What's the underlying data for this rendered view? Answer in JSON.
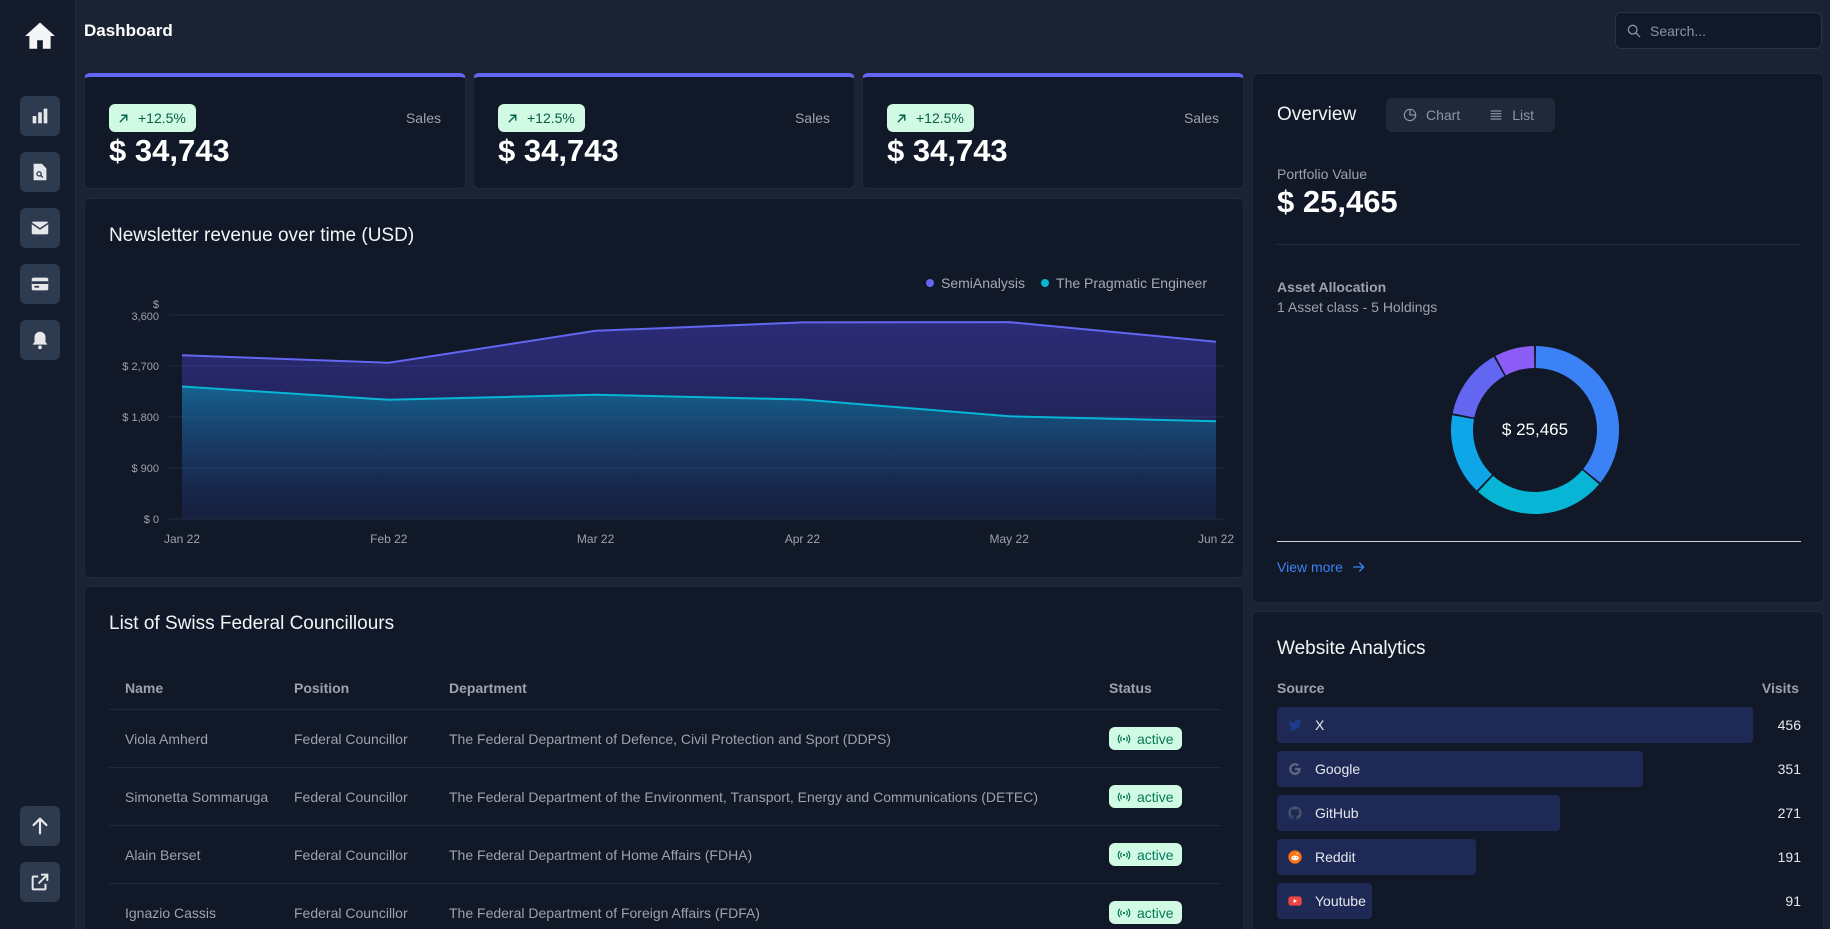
{
  "header": {
    "title": "Dashboard",
    "search_placeholder": "Search..."
  },
  "sidebar": {
    "items": [
      {
        "name": "analytics",
        "icon": "bar-chart-icon"
      },
      {
        "name": "documents",
        "icon": "document-search-icon"
      },
      {
        "name": "mail",
        "icon": "envelope-icon"
      },
      {
        "name": "payments",
        "icon": "credit-card-icon"
      },
      {
        "name": "notifications",
        "icon": "bell-icon"
      }
    ],
    "bottom": [
      {
        "name": "upload",
        "icon": "arrow-up-icon"
      },
      {
        "name": "external",
        "icon": "external-link-icon"
      }
    ]
  },
  "kpis": [
    {
      "badge": "+12.5%",
      "label": "Sales",
      "value": "$ 34,743"
    },
    {
      "badge": "+12.5%",
      "label": "Sales",
      "value": "$ 34,743"
    },
    {
      "badge": "+12.5%",
      "label": "Sales",
      "value": "$ 34,743"
    }
  ],
  "chart": {
    "title": "Newsletter revenue over time (USD)",
    "legend": [
      "SemiAnalysis",
      "The Pragmatic Engineer"
    ]
  },
  "chart_data": {
    "type": "area",
    "title": "Newsletter revenue over time (USD)",
    "x": [
      "Jan 22",
      "Feb 22",
      "Mar 22",
      "Apr 22",
      "May 22",
      "Jun 22"
    ],
    "y_ticks": [
      "$ 0",
      "$ 900",
      "$ 1,800",
      "$ 2,700",
      "$\n3,600"
    ],
    "ylim": [
      0,
      3600
    ],
    "grid": true,
    "legend_position": "top-right",
    "series": [
      {
        "name": "SemiAnalysis",
        "color": "#6366f1",
        "values": [
          2890,
          2756,
          3322,
          3470,
          3475,
          3129
        ]
      },
      {
        "name": "The Pragmatic Engineer",
        "color": "#06b6d4",
        "values": [
          2338,
          2103,
          2194,
          2108,
          1812,
          1726
        ]
      }
    ]
  },
  "table": {
    "title": "List of Swiss Federal Councillours",
    "columns": [
      "Name",
      "Position",
      "Department",
      "Status"
    ],
    "rows": [
      {
        "name": "Viola Amherd",
        "position": "Federal Councillor",
        "department": "The Federal Department of Defence, Civil Protection and Sport (DDPS)",
        "status": "active"
      },
      {
        "name": "Simonetta Sommaruga",
        "position": "Federal Councillor",
        "department": "The Federal Department of the Environment, Transport, Energy and Communications (DETEC)",
        "status": "active"
      },
      {
        "name": "Alain Berset",
        "position": "Federal Councillor",
        "department": "The Federal Department of Home Affairs (FDHA)",
        "status": "active"
      },
      {
        "name": "Ignazio Cassis",
        "position": "Federal Councillor",
        "department": "The Federal Department of Foreign Affairs (FDFA)",
        "status": "active"
      }
    ]
  },
  "overview": {
    "title": "Overview",
    "toggle": [
      "Chart",
      "List"
    ],
    "portfolio_label": "Portfolio Value",
    "portfolio_value": "$ 25,465",
    "allocation_title": "Asset Allocation",
    "allocation_sub": "1 Asset class - 5 Holdings",
    "donut_center": "$ 25,465",
    "donut_segments": [
      {
        "share": 0.36,
        "color": "#3b82f6"
      },
      {
        "share": 0.26,
        "color": "#06b6d4"
      },
      {
        "share": 0.16,
        "color": "#0ea5e9"
      },
      {
        "share": 0.14,
        "color": "#6366f1"
      },
      {
        "share": 0.08,
        "color": "#8b5cf6"
      }
    ],
    "view_more": "View more"
  },
  "analytics": {
    "title": "Website Analytics",
    "col_source": "Source",
    "col_visits": "Visits",
    "max": 456,
    "rows": [
      {
        "source": "X",
        "visits": 456,
        "icon": "twitter-icon",
        "icon_color": "#1e3a8a"
      },
      {
        "source": "Google",
        "visits": 351,
        "icon": "google-icon",
        "icon_color": "#3b4a66"
      },
      {
        "source": "GitHub",
        "visits": 271,
        "icon": "github-icon",
        "icon_color": "#334155"
      },
      {
        "source": "Reddit",
        "visits": 191,
        "icon": "reddit-icon",
        "icon_color": "#f97316"
      },
      {
        "source": "Youtube",
        "visits": 91,
        "icon": "youtube-icon",
        "icon_color": "#ef4444"
      }
    ]
  }
}
